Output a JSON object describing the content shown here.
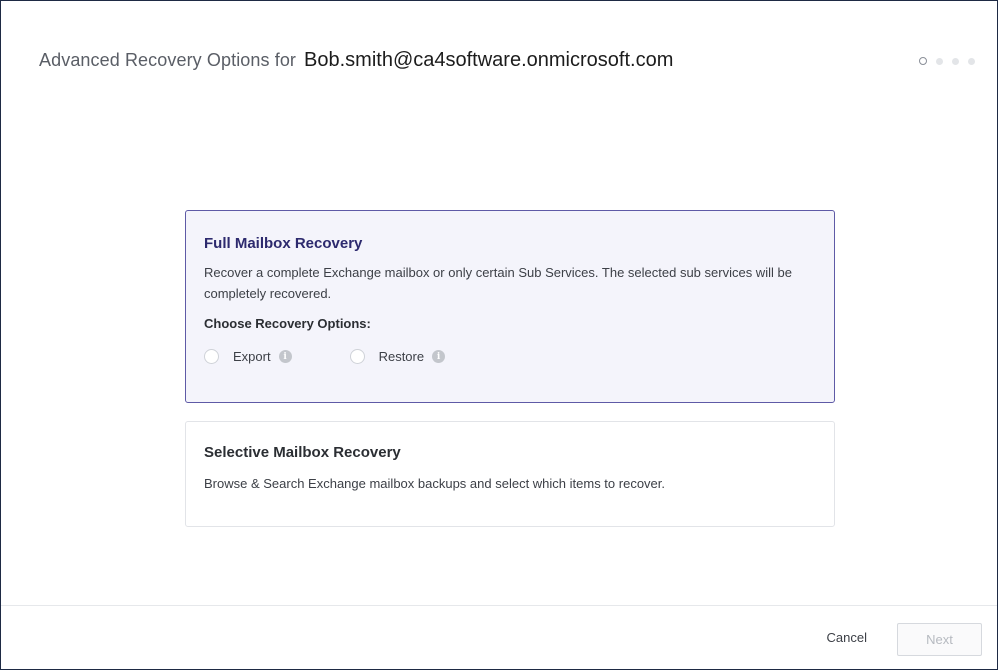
{
  "dialog": {
    "title_prefix": "Advanced Recovery Options for",
    "email": "Bob.smith@ca4software.onmicrosoft.com",
    "steps": {
      "total": 4,
      "current": 1
    }
  },
  "full_recovery": {
    "title": "Full Mailbox Recovery",
    "description": "Recover a complete Exchange mailbox or only certain Sub Services. The selected sub services will be completely recovered.",
    "options_heading": "Choose Recovery Options:",
    "options": [
      {
        "label": "Export",
        "selected": false,
        "icon": "info-icon"
      },
      {
        "label": "Restore",
        "selected": false,
        "icon": "info-icon"
      }
    ],
    "selected": true
  },
  "selective_recovery": {
    "title": "Selective Mailbox Recovery",
    "description": "Browse & Search Exchange mailbox backups and select which items to recover.",
    "selected": false
  },
  "footer": {
    "cancel_label": "Cancel",
    "next_label": "Next",
    "next_enabled": false
  },
  "colors": {
    "accent": "#5e5aa6",
    "selected_card_bg": "#f4f4fb",
    "selected_title": "#2d2a6e"
  }
}
